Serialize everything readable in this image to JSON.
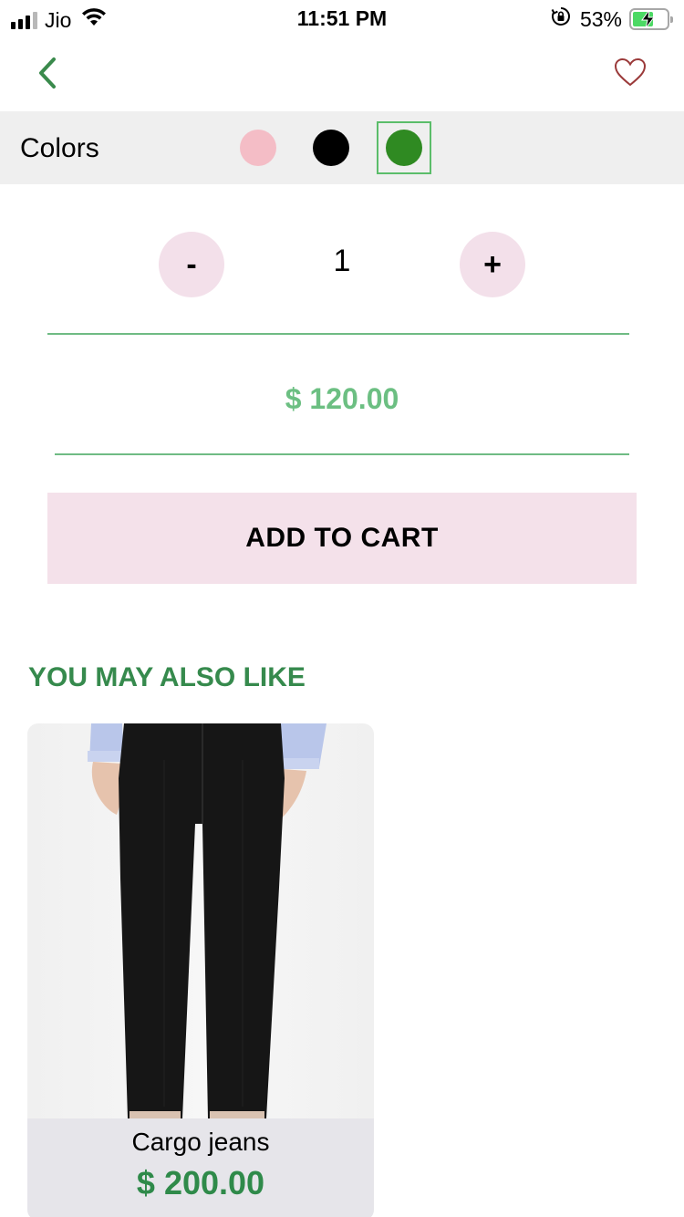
{
  "status_bar": {
    "carrier": "Jio",
    "time": "11:51 PM",
    "battery_percent": "53%",
    "battery_level": 0.53,
    "icons": [
      "signal-icon",
      "wifi-icon",
      "orientation-lock-icon",
      "battery-charging-icon"
    ]
  },
  "nav": {
    "back_icon": "chevron-left-icon",
    "favorite_icon": "heart-outline-icon",
    "accent_color": "#3a8a4c",
    "favorite_color": "#9b3a3a"
  },
  "colors": {
    "label": "Colors",
    "options": [
      "#f4bdc6",
      "#000000",
      "#2f8a22"
    ],
    "selected_index": 2
  },
  "quantity": {
    "minus_label": "-",
    "value": "1",
    "plus_label": "+"
  },
  "price": "$ 120.00",
  "add_to_cart": "ADD TO CART",
  "recommendations": {
    "title": "YOU MAY ALSO LIKE",
    "items": [
      {
        "name": "Cargo jeans",
        "price": "$ 200.00"
      }
    ]
  }
}
